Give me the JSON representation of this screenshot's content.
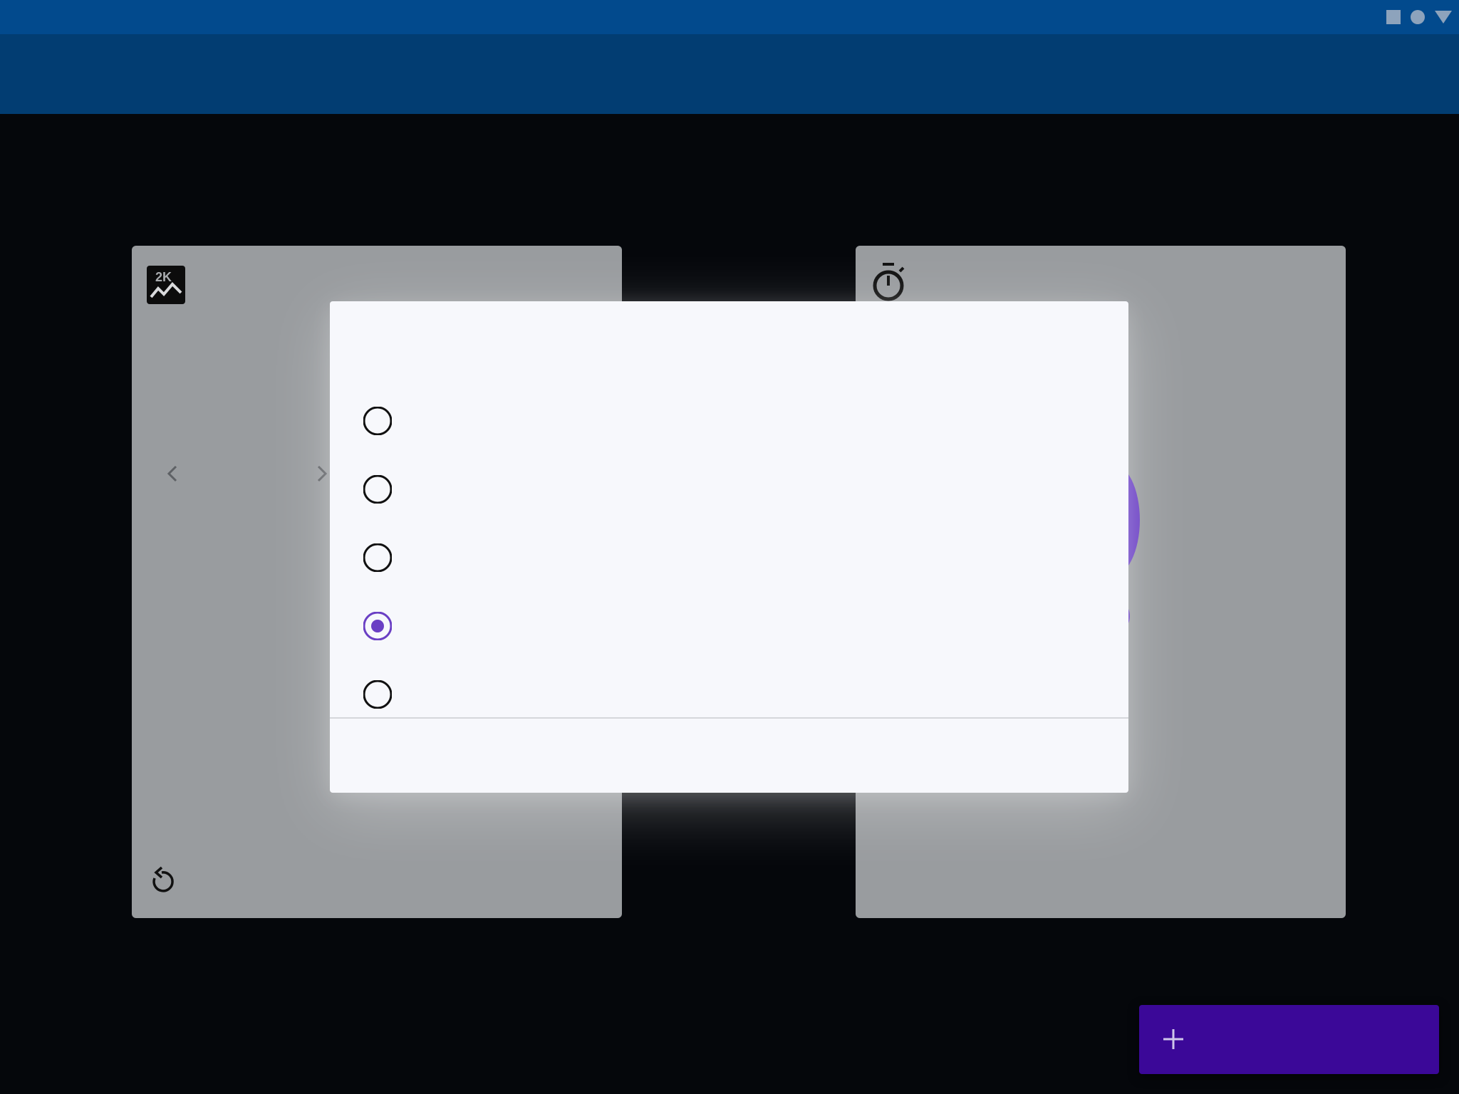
{
  "app": {
    "title": "",
    "accent_color": "#6a3fc4",
    "status_bar_color": "#024a8d",
    "app_bar_color": "#023d72"
  },
  "status_bar": {
    "icons": [
      "square-icon",
      "circle-icon",
      "triangle-icon"
    ]
  },
  "cards": {
    "left": {
      "top_icon": "chart-2k-icon",
      "nav_icons": [
        "chevron-left-icon",
        "chevron-right-icon"
      ],
      "bottom_icon": "reset-icon"
    },
    "right": {
      "top_icon": "timer-icon"
    }
  },
  "dialog": {
    "title": "",
    "selected_index": 3,
    "options": [
      {
        "label": "",
        "selected": false
      },
      {
        "label": "",
        "selected": false
      },
      {
        "label": "",
        "selected": false
      },
      {
        "label": "",
        "selected": true
      },
      {
        "label": "",
        "selected": false
      }
    ],
    "actions": [
      "",
      ""
    ]
  },
  "fab": {
    "icon": "plus-icon",
    "label": ""
  }
}
